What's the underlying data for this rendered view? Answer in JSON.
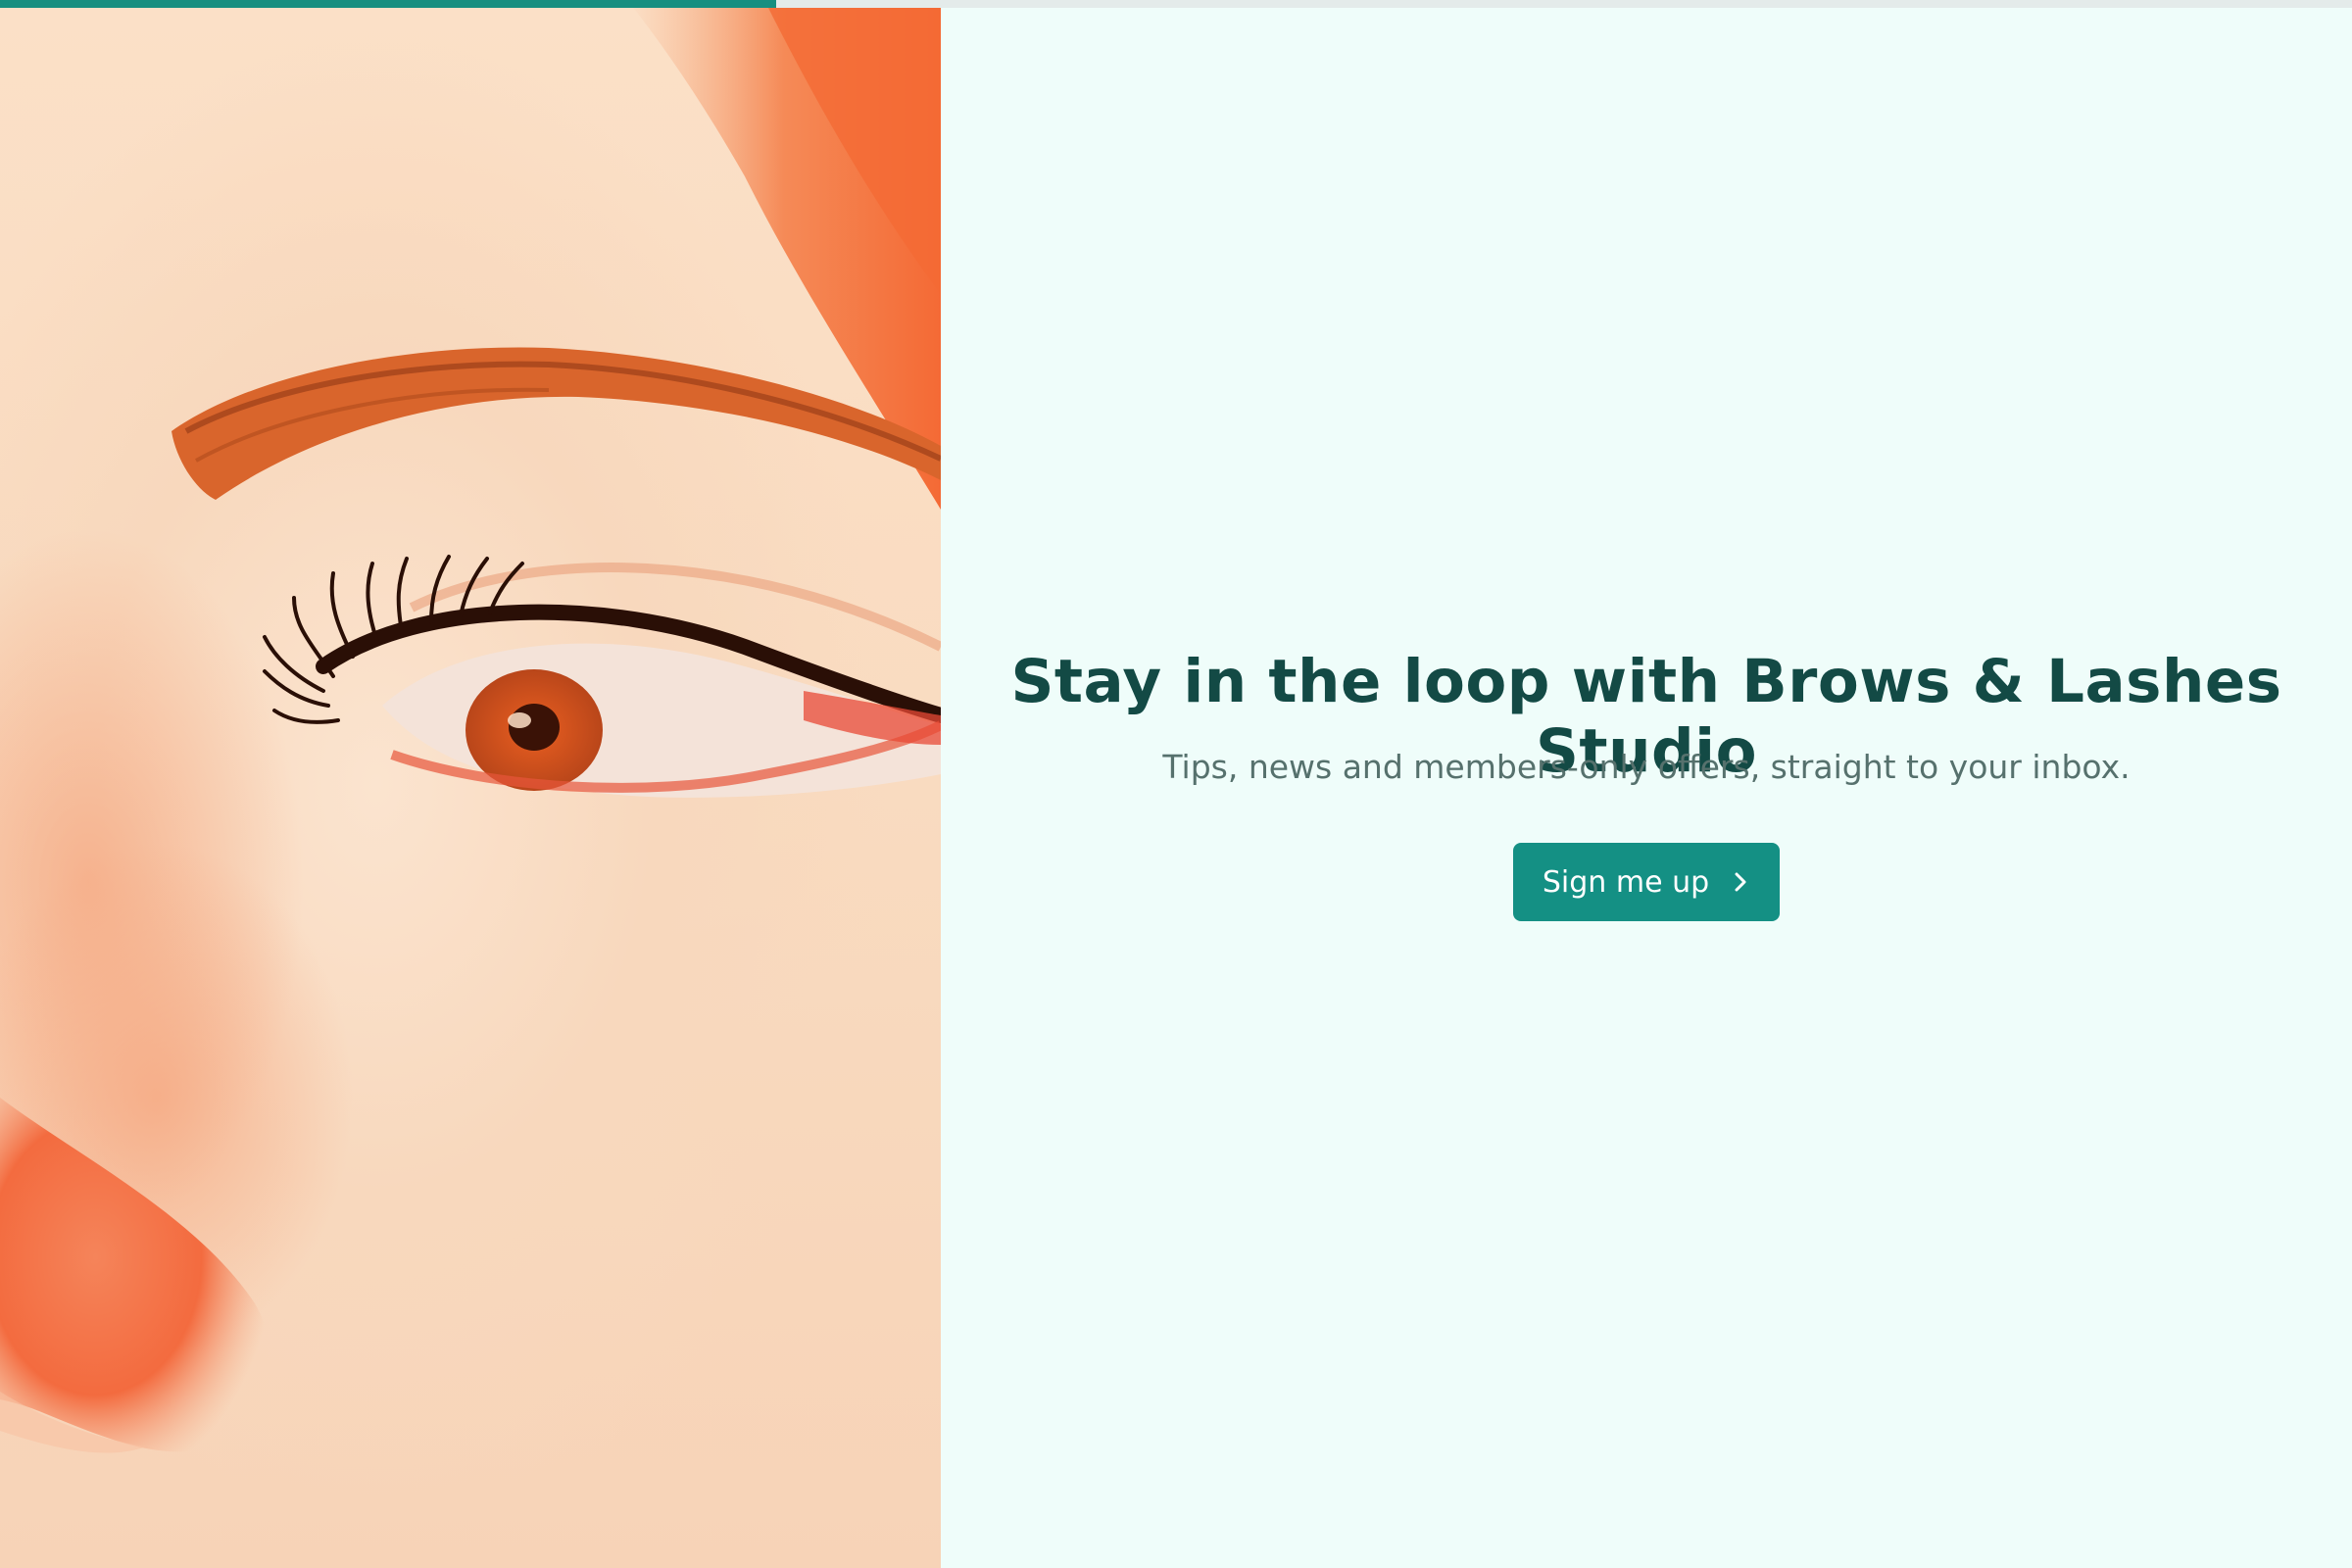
{
  "progress": {
    "value": 0.33,
    "fill_color": "#168f80",
    "track_color": "#e4ebea"
  },
  "hero": {
    "image": "close-up-eye-brow-lashes-photo"
  },
  "signup": {
    "headline": "Stay in the loop with Brows & Lashes Studio",
    "subtitle": "Tips, news and members-only offers, straight to your inbox.",
    "button_label": "Sign me up",
    "button_icon": "chevron-right-icon"
  },
  "colors": {
    "background": "#effdfa",
    "accent": "#149084",
    "heading": "#134a45",
    "body": "#56716d"
  }
}
